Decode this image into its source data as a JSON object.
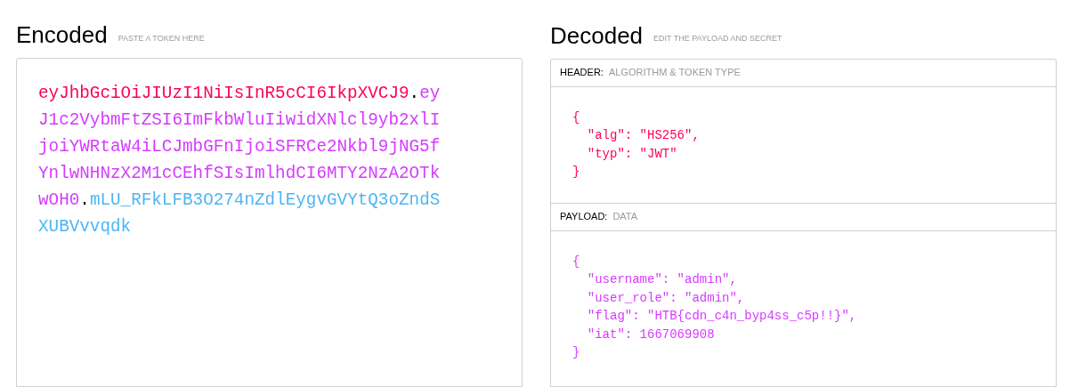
{
  "encoded": {
    "title": "Encoded",
    "subtitle": "PASTE A TOKEN HERE",
    "token": [
      {
        "kind": "header",
        "text": "eyJhbGciOiJIUzI1NiIsInR5cCI6IkpXVCJ9"
      },
      {
        "kind": "separator",
        "text": "."
      },
      {
        "kind": "payload",
        "text": "eyJ1c2VybmFtZSI6ImFkbWluIiwidXNlcl9yb2xlIjoiYWRtaW4iLCJmbGFnIjoiSFRCe2Nkbl9jNG5fYnlwNHNzX2M1cCEhfSIsImlhdCI6MTY2NzA2OTkwOH0"
      },
      {
        "kind": "separator",
        "text": "."
      },
      {
        "kind": "signature",
        "text": "mLU_RFkLFB3O274nZdlEygvGVYtQ3oZndSXUBVvvqdk"
      }
    ]
  },
  "decoded": {
    "title": "Decoded",
    "subtitle": "EDIT THE PAYLOAD AND SECRET",
    "sections": [
      {
        "kind": "header",
        "label": "HEADER:",
        "caption": "ALGORITHM & TOKEN TYPE",
        "lines": [
          "{",
          "  \"alg\": \"HS256\",",
          "  \"typ\": \"JWT\"",
          "}"
        ]
      },
      {
        "kind": "payload",
        "label": "PAYLOAD:",
        "caption": "DATA",
        "lines": [
          "{",
          "  \"username\": \"admin\",",
          "  \"user_role\": \"admin\",",
          "  \"flag\": \"HTB{cdn_c4n_byp4ss_c5p!!}\",",
          "  \"iat\": 1667069908",
          "}"
        ]
      }
    ]
  }
}
